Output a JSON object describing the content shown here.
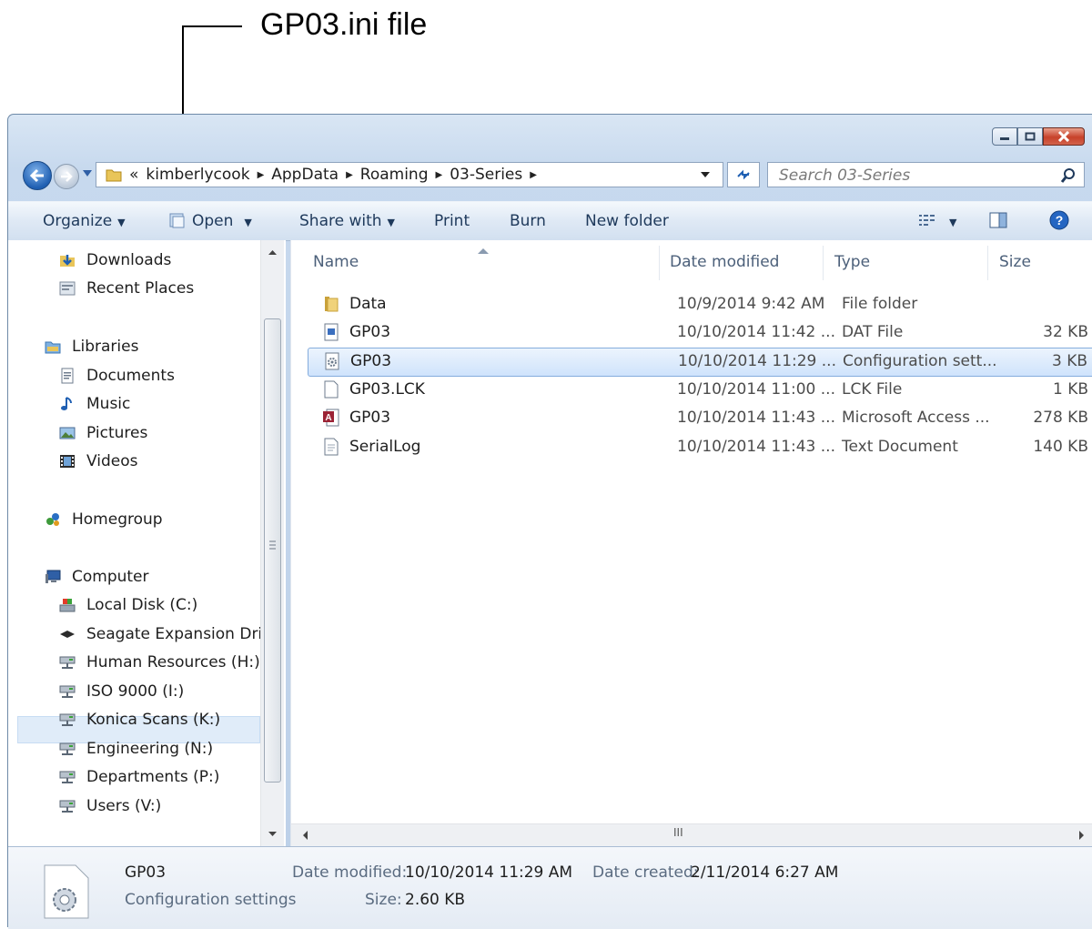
{
  "callout": {
    "label": "GP03.ini file"
  },
  "window": {
    "controls": [
      "minimize-icon",
      "maximize-icon",
      "close-icon"
    ]
  },
  "address_bar": {
    "overflow": "«",
    "crumbs": [
      "kimberlycook",
      "AppData",
      "Roaming",
      "03-Series"
    ],
    "search_placeholder": "Search 03-Series"
  },
  "toolbar": {
    "organize": "Organize",
    "open": "Open",
    "share_with": "Share with",
    "print": "Print",
    "burn": "Burn",
    "new_folder": "New folder"
  },
  "nav": {
    "downloads": "Downloads",
    "recent_places": "Recent Places",
    "libraries": "Libraries",
    "documents": "Documents",
    "music": "Music",
    "pictures": "Pictures",
    "videos": "Videos",
    "homegroup": "Homegroup",
    "computer": "Computer",
    "local_disk": "Local Disk (C:)",
    "seagate": "Seagate Expansion Drive",
    "hr": "Human Resources (H:)",
    "iso": "ISO 9000 (I:)",
    "konica": "Konica Scans (K:)",
    "engineering": "Engineering (N:)",
    "departments": "Departments (P:)",
    "users": "Users (V:)"
  },
  "columns": {
    "name": "Name",
    "date": "Date modified",
    "type": "Type",
    "size": "Size"
  },
  "files": [
    {
      "name": "Data",
      "date": "10/9/2014 9:42 AM",
      "type": "File folder",
      "size": "",
      "icon": "folder-icon"
    },
    {
      "name": "GP03",
      "date": "10/10/2014 11:42 ...",
      "type": "DAT File",
      "size": "32 KB",
      "icon": "dat-file-icon"
    },
    {
      "name": "GP03",
      "date": "10/10/2014 11:29 ...",
      "type": "Configuration sett...",
      "size": "3 KB",
      "icon": "config-file-icon"
    },
    {
      "name": "GP03.LCK",
      "date": "10/10/2014 11:00 ...",
      "type": "LCK File",
      "size": "1 KB",
      "icon": "blank-file-icon"
    },
    {
      "name": "GP03",
      "date": "10/10/2014 11:43 ...",
      "type": "Microsoft Access ...",
      "size": "278 KB",
      "icon": "access-file-icon"
    },
    {
      "name": "SerialLog",
      "date": "10/10/2014 11:43 ...",
      "type": "Text Document",
      "size": "140 KB",
      "icon": "text-file-icon"
    }
  ],
  "details": {
    "name": "GP03",
    "type": "Configuration settings",
    "modified_label": "Date modified:",
    "modified_value": "10/10/2014 11:29 AM",
    "created_label": "Date created:",
    "created_value": "2/11/2014 6:27 AM",
    "size_label": "Size:",
    "size_value": "2.60 KB"
  },
  "hscroll_grip": "III"
}
